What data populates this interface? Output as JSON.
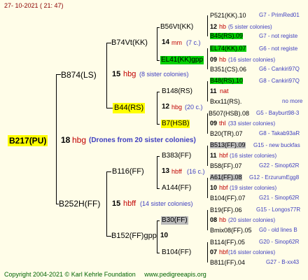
{
  "header": {
    "date": "27- 10-2021 ( 21: 47)"
  },
  "colors": {
    "background": "#fffde8",
    "yellow_hl": "#ffff00",
    "green_hl": "#00d000",
    "gray_hl": "#bbbbbb",
    "red": "#c00000",
    "blue": "#4040c0"
  },
  "root": {
    "id": "B217(PU)",
    "num": "18",
    "tag": "hbg",
    "note": "(Drones from 20 sister colonies)"
  },
  "gen1": [
    {
      "id": "B874(LS)",
      "num": "15",
      "tag": "hbg",
      "note": "(8 sister colonies)"
    },
    {
      "id": "B252H(FF)",
      "num": "15",
      "tag": "hbff",
      "note": "(14 sister colonies)"
    }
  ],
  "gen2": [
    {
      "id": "B74Vt(KK)",
      "num": "14",
      "tag": "mm",
      "note": "(7 c.)"
    },
    {
      "id": "B44(RS)",
      "num": "12",
      "tag": "hbg",
      "note": "(20 c.)"
    },
    {
      "id": "B116(FF)",
      "num": "13",
      "tag": "hbff",
      "note": "(16 c.)"
    },
    {
      "id": "B152(FF)gpp",
      "num": "10",
      "tag": "",
      "note": ""
    }
  ],
  "gen3": [
    {
      "id": "B56Vt(KK)",
      "num": "12",
      "tag": "hb",
      "note": "(5 sister colonies)"
    },
    {
      "id": "EL41(KK)gpp",
      "num": "09",
      "tag": "hb",
      "note": "(16 sister colonies)"
    },
    {
      "id": "B148(RS)",
      "num": "11",
      "tag": "nat",
      "note": ""
    },
    {
      "id": "B7(HSB)",
      "num": "09",
      "tag": "thl",
      "note": "(33 sister colonies)"
    },
    {
      "id": "B383(FF)",
      "num": "11",
      "tag": "hbf",
      "note": "(16 sister colonies)"
    },
    {
      "id": "A144(FF)",
      "num": "10",
      "tag": "hbf",
      "note": "(19 sister colonies)"
    },
    {
      "id": "B30(FF)",
      "num": "08",
      "tag": "hb",
      "note": "(20 sister colonies)"
    },
    {
      "id": "B104(FF)",
      "num": "07",
      "tag": "hbf",
      "note": "(16 sister colonies)"
    }
  ],
  "gen4": [
    {
      "id": "P521(KK).10",
      "info": "G7 - PrimRed01"
    },
    {
      "id": "B45(RS).09",
      "info": "G7 - not registe"
    },
    {
      "id": "EL74(KK).07",
      "info": "G6 - not registe"
    },
    {
      "id": "B351(CS).06",
      "info": "G6 - Cankiri97Q"
    },
    {
      "id": "B48(RS).10",
      "info": "G8 - Cankiri97Q"
    },
    {
      "id": "Bxx11(RS).",
      "info": "no more"
    },
    {
      "id": "B507(HSB).08",
      "info": "G5 - Bayburt98-3"
    },
    {
      "id": "B20(TR).07",
      "info": "G8 - Takab93aR"
    },
    {
      "id": "B513(FF).09",
      "info": "G15 - new buckfas"
    },
    {
      "id": "B58(FF).07",
      "info": "G22 - Sinop62R"
    },
    {
      "id": "A61(FF).08",
      "info": "G12 - ErzurumEgg8"
    },
    {
      "id": "B104(FF).07",
      "info": "G21 - Sinop62R"
    },
    {
      "id": "B19(FF).06",
      "info": "G15 - Longos77R"
    },
    {
      "id": "Bmix08(FF).05",
      "info": "G0 - old lines B"
    },
    {
      "id": "B114(FF).05",
      "info": "G20 - Sinop62R"
    },
    {
      "id": "B811(FF).04",
      "info": "G27 - B-xx43"
    }
  ],
  "footer": {
    "copyright": "Copyright 2004-2021 © Karl Kehrle Foundation",
    "site": "www.pedigreeapis.org"
  }
}
